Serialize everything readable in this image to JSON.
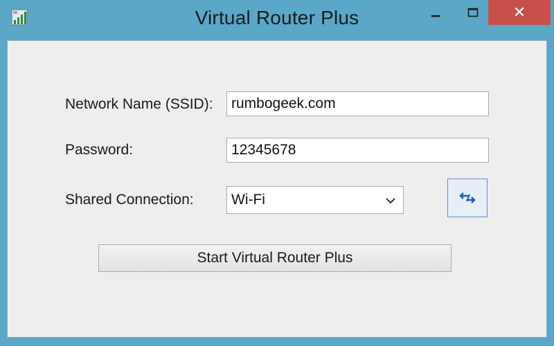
{
  "window": {
    "title": "Virtual Router Plus",
    "close_glyph": "✕",
    "app_icon": "signal-bars-icon",
    "close_color": "#c7504a",
    "titlebar_color": "#5aa7c8"
  },
  "form": {
    "ssid_label": "Network Name (SSID):",
    "ssid_value": "rumbogeek.com",
    "password_label": "Password:",
    "password_value": "12345678",
    "shared_label": "Shared Connection:",
    "shared_value": "Wi-Fi",
    "refresh_icon": "refresh-arrows-icon",
    "start_label": "Start Virtual Router Plus"
  }
}
